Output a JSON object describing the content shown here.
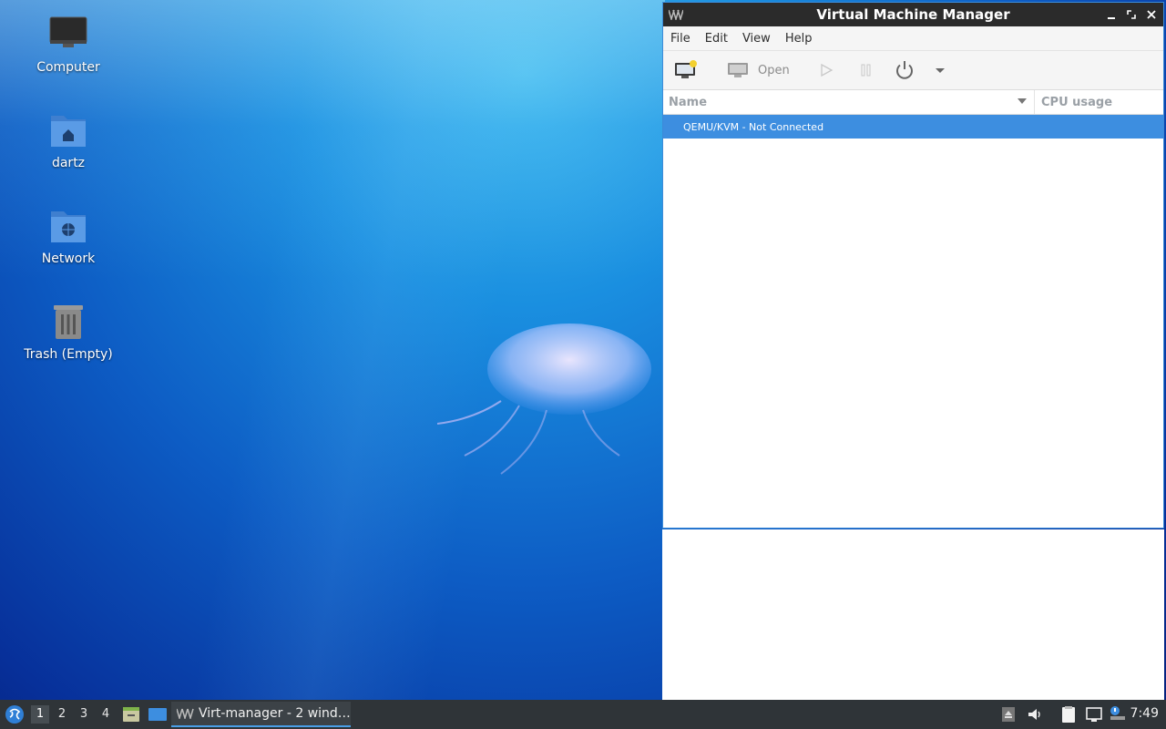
{
  "desktop": {
    "icons": [
      {
        "label": "Computer",
        "icon": "computer-icon"
      },
      {
        "label": "dartz",
        "icon": "home-folder-icon"
      },
      {
        "label": "Network",
        "icon": "network-folder-icon"
      },
      {
        "label": "Trash (Empty)",
        "icon": "trash-icon"
      }
    ]
  },
  "window": {
    "title": "Virtual Machine Manager",
    "menu": [
      "File",
      "Edit",
      "View",
      "Help"
    ],
    "toolbar": {
      "open_label": "Open"
    },
    "columns": {
      "name": "Name",
      "cpu": "CPU usage"
    },
    "rows": [
      {
        "label": "QEMU/KVM - Not Connected",
        "selected": true
      }
    ]
  },
  "taskbar": {
    "workspaces": [
      "1",
      "2",
      "3",
      "4"
    ],
    "active_workspace": "1",
    "task_label": "Virt-manager - 2 wind…",
    "clock": "7:49"
  },
  "colors": {
    "accent": "#3d8ee0",
    "titlebar": "#2b2b2b",
    "taskbar": "#2f3438"
  }
}
